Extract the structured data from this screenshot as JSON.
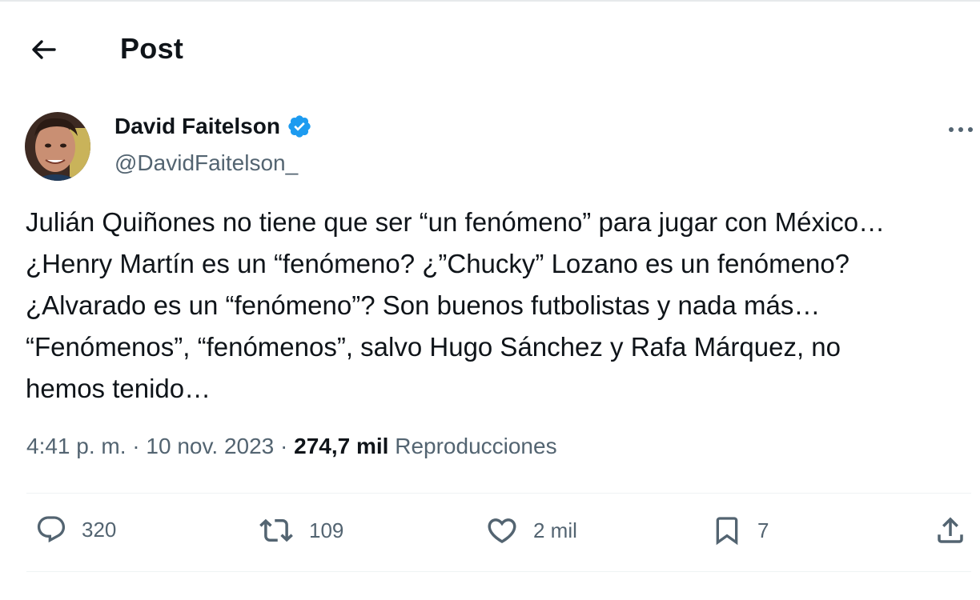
{
  "header": {
    "title": "Post"
  },
  "author": {
    "display_name": "David Faitelson",
    "handle": "@DavidFaitelson_",
    "verified": true
  },
  "tweet": {
    "lines": [
      "Julián Quiñones no tiene que ser “un fenómeno” para jugar con México…",
      "¿Henry Martín es un “fenómeno? ¿”Chucky” Lozano es un fenómeno?",
      "¿Alvarado es un “fenómeno”? Son buenos futbolistas y nada más…",
      "“Fenómenos”, “fenómenos”, salvo Hugo Sánchez y Rafa Márquez, no",
      "hemos tenido…"
    ]
  },
  "meta": {
    "time": "4:41 p. m.",
    "sep1": " · ",
    "date": "10 nov. 2023",
    "sep2": " · ",
    "views_count": "274,7 mil",
    "views_label": "Reproducciones"
  },
  "actions": {
    "replies": "320",
    "reposts": "109",
    "likes": "2 mil",
    "bookmarks": "7"
  },
  "colors": {
    "text": "#0f1419",
    "secondary": "#536471",
    "verified": "#1d9bf0",
    "divider": "#eff3f4"
  },
  "icons": [
    "back-arrow-icon",
    "verified-badge-icon",
    "more-icon",
    "reply-icon",
    "repost-icon",
    "like-icon",
    "bookmark-icon",
    "share-icon"
  ]
}
